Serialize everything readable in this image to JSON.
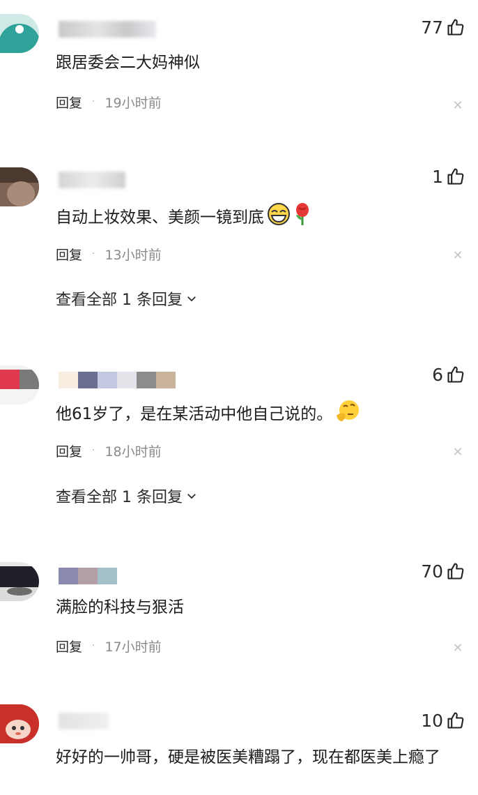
{
  "icons": {
    "like": "thumbs-up-icon",
    "close": "close-icon",
    "chevron": "chevron-down-icon"
  },
  "reply_label": "回复",
  "view_replies": "查看全部 1 条回复",
  "comments": [
    {
      "likes": "77",
      "text": "跟居委会二大妈神似",
      "time": "19小时前"
    },
    {
      "likes": "1",
      "text": "自动上妆效果、美颜一镜到底",
      "time": "13小时前"
    },
    {
      "likes": "6",
      "text": "他61岁了，是在某活动中他自己说的。",
      "time": "18小时前"
    },
    {
      "likes": "70",
      "text": "满脸的科技与狠活",
      "time": "17小时前"
    },
    {
      "likes": "10",
      "text": "好好的一帅哥，硬是被医美糟蹋了，现在都医美上瘾了"
    }
  ]
}
